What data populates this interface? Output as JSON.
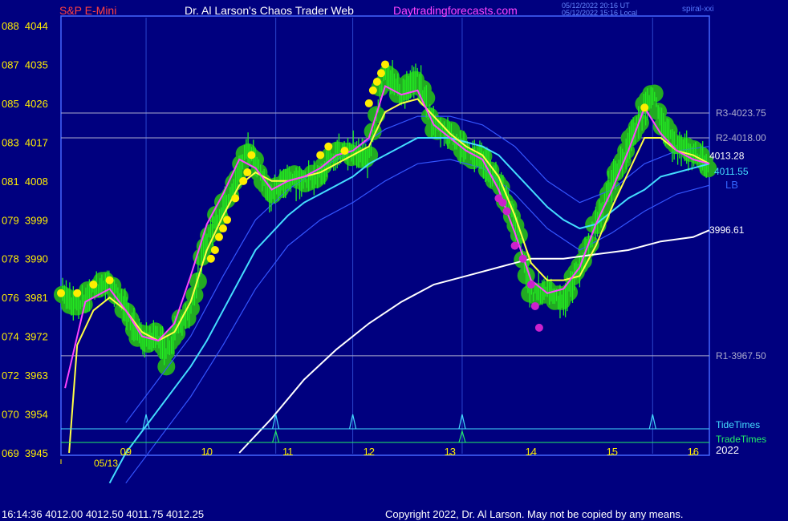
{
  "header": {
    "symbol": "S&P E-Mini",
    "author": "Dr. Al Larson's Chaos Trader Web",
    "site": "Daytradingforecasts.com",
    "stamp_utc": "05/12/2022 20:16 UT",
    "stamp_local": "05/12/2022 15:16 Local",
    "spiral_tag": "spiral-xxi"
  },
  "footer": {
    "quote": "16:14:36  4012.00 4012.50 4011.75 4012.25",
    "copyright": "Copyright 2022, Dr. Al Larson. May not be copied by any means."
  },
  "colors": {
    "background": "#00007f",
    "plot_border": "#4466ff",
    "price_bars": "#22ee22",
    "glow": "#22aa22",
    "fast_avg": "#ff44ff",
    "slow_avg": "#ffff44",
    "channel_mid": "#44ddff",
    "channel_bands": "#3355ff",
    "long_avg": "#ffffff",
    "dots_yellow": "#ffee00",
    "dots_magenta": "#cc22cc",
    "tide": "#44ddff",
    "trade": "#22ee66",
    "level_lines": "#aaaacc"
  },
  "chart_data": {
    "type": "line",
    "title": "S&P E-Mini",
    "xlabel": "",
    "ylabel": "",
    "ylim": [
      3945,
      4044
    ],
    "y_ticks": [
      {
        "label": "088  4044",
        "value": 4044
      },
      {
        "label": "087  4035",
        "value": 4035
      },
      {
        "label": "085  4026",
        "value": 4026
      },
      {
        "label": "083  4017",
        "value": 4017
      },
      {
        "label": "081  4008",
        "value": 4008
      },
      {
        "label": "079  3999",
        "value": 3999
      },
      {
        "label": "078  3990",
        "value": 3990
      },
      {
        "label": "076  3981",
        "value": 3981
      },
      {
        "label": "074  3972",
        "value": 3972
      },
      {
        "label": "072  3963",
        "value": 3963
      },
      {
        "label": "070  3954",
        "value": 3954
      },
      {
        "label": "069  3945",
        "value": 3945
      }
    ],
    "x_range": [
      8.2,
      16.2
    ],
    "x_ticks": [
      {
        "label": "09",
        "value": 9
      },
      {
        "label": "10",
        "value": 10
      },
      {
        "label": "11",
        "value": 11
      },
      {
        "label": "12",
        "value": 12
      },
      {
        "label": "13",
        "value": 13
      },
      {
        "label": "14",
        "value": 14
      },
      {
        "label": "15",
        "value": 15
      },
      {
        "label": "16",
        "value": 16
      }
    ],
    "date_label": "05/13",
    "year_label": "2022",
    "vertical_grid_x": [
      9.25,
      10.85,
      11.8,
      13.15,
      15.5
    ],
    "levels": [
      {
        "name": "R3",
        "label": "R3-4023.75",
        "value": 4023.75
      },
      {
        "name": "R2",
        "label": "R2-4018.00",
        "value": 4018.0
      },
      {
        "name": "R1",
        "label": "R1-3967.50",
        "value": 3967.5
      }
    ],
    "price": {
      "x": [
        8.2,
        8.4,
        8.6,
        8.8,
        9.0,
        9.2,
        9.4,
        9.5,
        9.6,
        9.8,
        10.0,
        10.2,
        10.4,
        10.5,
        10.6,
        10.8,
        11.0,
        11.2,
        11.4,
        11.6,
        11.8,
        12.0,
        12.1,
        12.2,
        12.4,
        12.6,
        12.8,
        13.0,
        13.2,
        13.4,
        13.6,
        13.8,
        14.0,
        14.2,
        14.4,
        14.6,
        14.8,
        15.0,
        15.2,
        15.4,
        15.5,
        15.6,
        15.8,
        16.0,
        16.2
      ],
      "y": [
        3982,
        3979,
        3983,
        3985,
        3978,
        3971,
        3972,
        3968,
        3973,
        3978,
        3995,
        4002,
        4010,
        4016,
        4013,
        4004,
        4009,
        4008,
        4010,
        4014,
        4015,
        4013,
        4025,
        4034,
        4028,
        4032,
        4021,
        4019,
        4015,
        4013,
        4008,
        3999,
        3982,
        3983,
        3980,
        3988,
        3998,
        4008,
        4016,
        4025,
        4029,
        4021,
        4016,
        4014,
        4012
      ]
    },
    "series": [
      {
        "name": "fast",
        "x": [
          8.25,
          8.5,
          8.8,
          9.0,
          9.2,
          9.4,
          9.6,
          9.8,
          10.0,
          10.2,
          10.4,
          10.6,
          10.8,
          11.0,
          11.2,
          11.4,
          11.6,
          11.8,
          12.0,
          12.2,
          12.4,
          12.6,
          12.8,
          13.0,
          13.2,
          13.4,
          13.6,
          13.8,
          14.0,
          14.2,
          14.4,
          14.6,
          14.8,
          15.0,
          15.2,
          15.4,
          15.6,
          15.8,
          16.0,
          16.2
        ],
        "y": [
          3960,
          3980,
          3983,
          3978,
          3972,
          3971,
          3975,
          3986,
          3998,
          4005,
          4013,
          4011,
          4006,
          4008,
          4009,
          4011,
          4014,
          4015,
          4018,
          4030,
          4028,
          4029,
          4021,
          4018,
          4015,
          4013,
          4006,
          3996,
          3985,
          3982,
          3983,
          3988,
          3998,
          4006,
          4015,
          4025,
          4019,
          4015,
          4013,
          4012
        ]
      },
      {
        "name": "slow",
        "x": [
          8.3,
          8.4,
          8.6,
          8.8,
          9.0,
          9.2,
          9.4,
          9.6,
          9.8,
          10.0,
          10.2,
          10.4,
          10.6,
          10.8,
          11.0,
          11.2,
          11.4,
          11.6,
          11.8,
          12.0,
          12.2,
          12.4,
          12.6,
          12.8,
          13.0,
          13.2,
          13.4,
          13.6,
          13.8,
          14.0,
          14.2,
          14.4,
          14.6,
          14.8,
          15.0,
          15.2,
          15.4,
          15.6,
          15.8,
          16.0,
          16.2
        ],
        "y": [
          3945,
          3970,
          3978,
          3981,
          3978,
          3973,
          3971,
          3973,
          3980,
          3992,
          4000,
          4007,
          4010,
          4008,
          4008,
          4009,
          4010,
          4012,
          4014,
          4016,
          4024,
          4026,
          4027,
          4023,
          4019,
          4016,
          4014,
          4009,
          4000,
          3989,
          3985,
          3985,
          3986,
          3993,
          4002,
          4010,
          4018,
          4018,
          4015,
          4014,
          4012
        ]
      },
      {
        "name": "channel",
        "x": [
          8.8,
          9.0,
          9.2,
          9.4,
          9.6,
          9.8,
          10.0,
          10.2,
          10.4,
          10.6,
          10.8,
          11.0,
          11.2,
          11.4,
          11.6,
          11.8,
          12.0,
          12.2,
          12.4,
          12.6,
          12.8,
          13.0,
          13.2,
          13.4,
          13.6,
          13.8,
          14.0,
          14.2,
          14.4,
          14.6,
          14.8,
          15.0,
          15.2,
          15.4,
          15.6,
          15.8,
          16.0,
          16.2
        ],
        "y": [
          3938,
          3945,
          3950,
          3955,
          3960,
          3965,
          3971,
          3978,
          3985,
          3992,
          3996,
          4000,
          4003,
          4005,
          4007,
          4009,
          4012,
          4014,
          4016,
          4018,
          4018,
          4018,
          4017,
          4016,
          4014,
          4010,
          4006,
          4002,
          3999,
          3997,
          3998,
          4001,
          4004,
          4006,
          4009,
          4010,
          4011,
          4012
        ]
      },
      {
        "name": "band-upper",
        "x": [
          9.0,
          9.4,
          9.8,
          10.2,
          10.6,
          11.0,
          11.4,
          11.8,
          12.2,
          12.6,
          13.0,
          13.4,
          13.8,
          14.2,
          14.6,
          15.0,
          15.4,
          15.8,
          16.2
        ],
        "y": [
          3952,
          3962,
          3972,
          3986,
          3999,
          4006,
          4011,
          4015,
          4020,
          4023,
          4023,
          4021,
          4016,
          4008,
          4003,
          4006,
          4012,
          4015,
          4016
        ]
      },
      {
        "name": "band-lower",
        "x": [
          9.0,
          9.4,
          9.8,
          10.2,
          10.6,
          11.0,
          11.4,
          11.8,
          12.2,
          12.6,
          13.0,
          13.4,
          13.8,
          14.2,
          14.6,
          15.0,
          15.4,
          15.8,
          16.2
        ],
        "y": [
          3938,
          3948,
          3958,
          3970,
          3983,
          3993,
          3999,
          4003,
          4008,
          4012,
          4013,
          4011,
          4005,
          3997,
          3992,
          3996,
          4001,
          4005,
          4007
        ]
      },
      {
        "name": "long",
        "x": [
          10.4,
          10.8,
          11.2,
          11.6,
          12.0,
          12.4,
          12.8,
          13.2,
          13.6,
          14.0,
          14.4,
          14.8,
          15.2,
          15.6,
          16.0,
          16.2
        ],
        "y": [
          3945,
          3953,
          3962,
          3969,
          3975,
          3980,
          3984,
          3986,
          3988,
          3990,
          3990,
          3991,
          3992,
          3994,
          3995,
          3996.6
        ]
      }
    ],
    "dots_yellow": [
      [
        8.2,
        3982
      ],
      [
        8.4,
        3982
      ],
      [
        8.6,
        3984
      ],
      [
        8.8,
        3985
      ],
      [
        10.05,
        3990
      ],
      [
        10.1,
        3992
      ],
      [
        10.15,
        3995
      ],
      [
        10.2,
        3997
      ],
      [
        10.25,
        3999
      ],
      [
        10.35,
        4004
      ],
      [
        10.45,
        4008
      ],
      [
        10.5,
        4010
      ],
      [
        10.55,
        4014
      ],
      [
        11.4,
        4014
      ],
      [
        11.5,
        4016
      ],
      [
        11.7,
        4015
      ],
      [
        12.0,
        4026
      ],
      [
        12.05,
        4029
      ],
      [
        12.1,
        4031
      ],
      [
        12.15,
        4033
      ],
      [
        12.2,
        4035
      ],
      [
        15.4,
        4025
      ]
    ],
    "dots_magenta": [
      [
        13.6,
        4004
      ],
      [
        13.65,
        4003
      ],
      [
        13.7,
        4001
      ],
      [
        13.8,
        3993
      ],
      [
        13.9,
        3990
      ],
      [
        14.0,
        3984
      ],
      [
        14.05,
        3979
      ],
      [
        14.1,
        3974
      ]
    ],
    "end_labels": [
      {
        "label": "4013.28",
        "value": 4013.28
      },
      {
        "label": "4011.55",
        "value": 4011.55
      },
      {
        "label": "3996.61",
        "value": 3996.61
      }
    ],
    "lb_label": "LB",
    "tide_label": "TideTimes",
    "tide_spikes": [
      9.25,
      10.85,
      11.8,
      13.15,
      15.5
    ],
    "trade_label": "TradeTimes",
    "trade_spikes": [
      10.85,
      13.15
    ]
  }
}
